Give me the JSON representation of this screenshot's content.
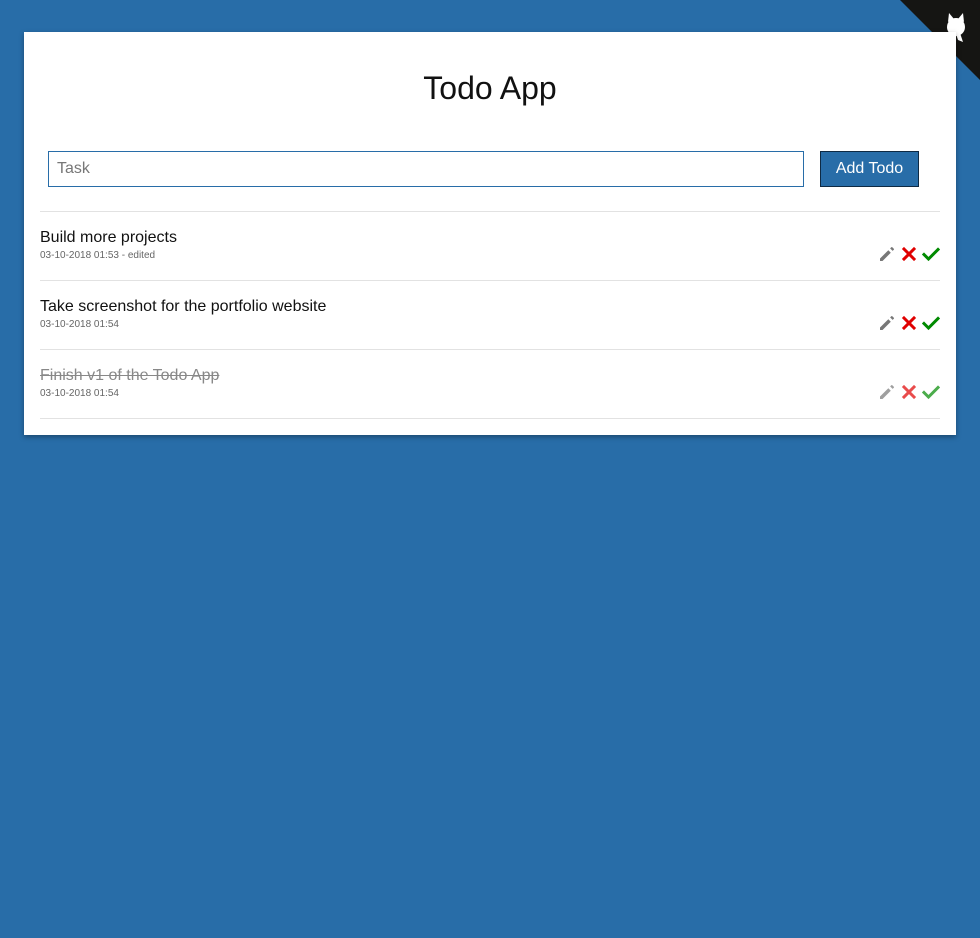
{
  "app": {
    "title": "Todo App"
  },
  "form": {
    "task_placeholder": "Task",
    "task_value": "",
    "add_label": "Add Todo"
  },
  "todos": [
    {
      "text": "Build more projects",
      "meta": "03-10-2018 01:53 - edited",
      "done": false
    },
    {
      "text": "Take screenshot for the portfolio website",
      "meta": "03-10-2018 01:54",
      "done": false
    },
    {
      "text": "Finish v1 of the Todo App",
      "meta": "03-10-2018 01:54",
      "done": true
    }
  ],
  "icons": {
    "corner": "github-octocat-icon",
    "edit": "pencil-icon",
    "delete": "close-icon",
    "complete": "check-icon"
  },
  "colors": {
    "background": "#286da8",
    "accent": "#286da8",
    "delete": "#e00000",
    "complete": "#008a00",
    "edit": "#777777"
  }
}
